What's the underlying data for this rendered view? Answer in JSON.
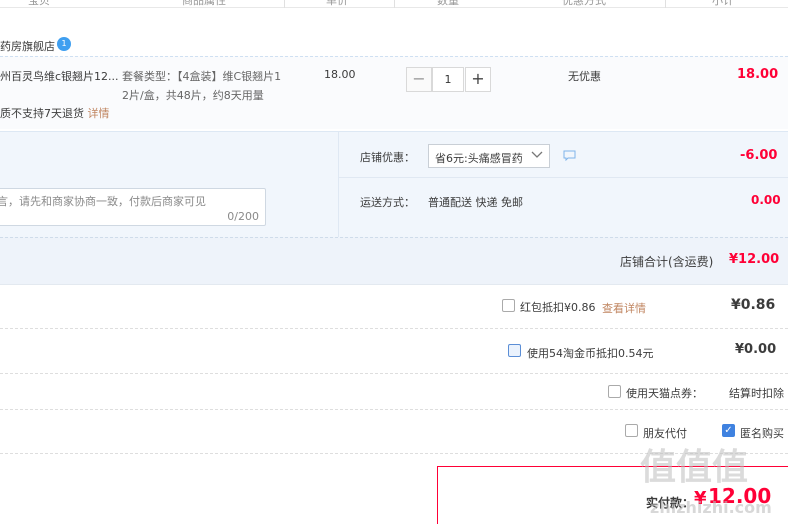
{
  "header": {
    "cols": [
      "宝贝",
      "商品属性",
      "单价",
      "数量",
      "优惠方式",
      "小计"
    ]
  },
  "shop": {
    "name": "药房旗舰店",
    "badge": "1"
  },
  "item": {
    "title": "州百灵鸟维c银翘片12...",
    "attr_line1": "套餐类型：【4盒装】维C银翘片1",
    "attr_line2": "2片/盒，共48片，约8天用量",
    "notice": "质不支持7天退货",
    "notice_link": "详情",
    "price": "18.00",
    "qty_minus": "−",
    "qty": "1",
    "qty_plus": "+",
    "discount": "无优惠",
    "subtotal": "18.00"
  },
  "shop_panel": {
    "message_placeholder": "言，请先和商家协商一致，付款后商家可见",
    "message_count": "0/200",
    "coupon_label": "店铺优惠：",
    "coupon_selected": "省6元:头痛感冒药",
    "coupon_amount": "-6.00",
    "shipping_label": "运送方式：",
    "shipping_value": "普通配送 快递 免邮",
    "shipping_cost": "0.00"
  },
  "shop_total": {
    "label": "店铺合计(含运费)",
    "value": "¥12.00"
  },
  "options": {
    "redpacket_label": "红包抵扣¥0.86",
    "redpacket_link": "查看详情",
    "redpacket_value": "¥0.86",
    "coins_label": "使用54淘金币抵扣0.54元",
    "coins_value": "¥0.00",
    "tmall_points_label": "使用天猫点券：",
    "tmall_points_value": "结算时扣除",
    "friend_pay_label": "朋友代付",
    "anonymous_label": "匿名购买",
    "anonymous_checked": "✓"
  },
  "pay": {
    "label": "实付款：",
    "currency": "¥",
    "amount": "12.00"
  },
  "watermark": {
    "big": "值值值",
    "small": "zhizhizhi.com"
  },
  "colors": {
    "accent_red": "#ff0036",
    "panel_blue": "#f1f6fc",
    "link_orange": "#c08560"
  }
}
